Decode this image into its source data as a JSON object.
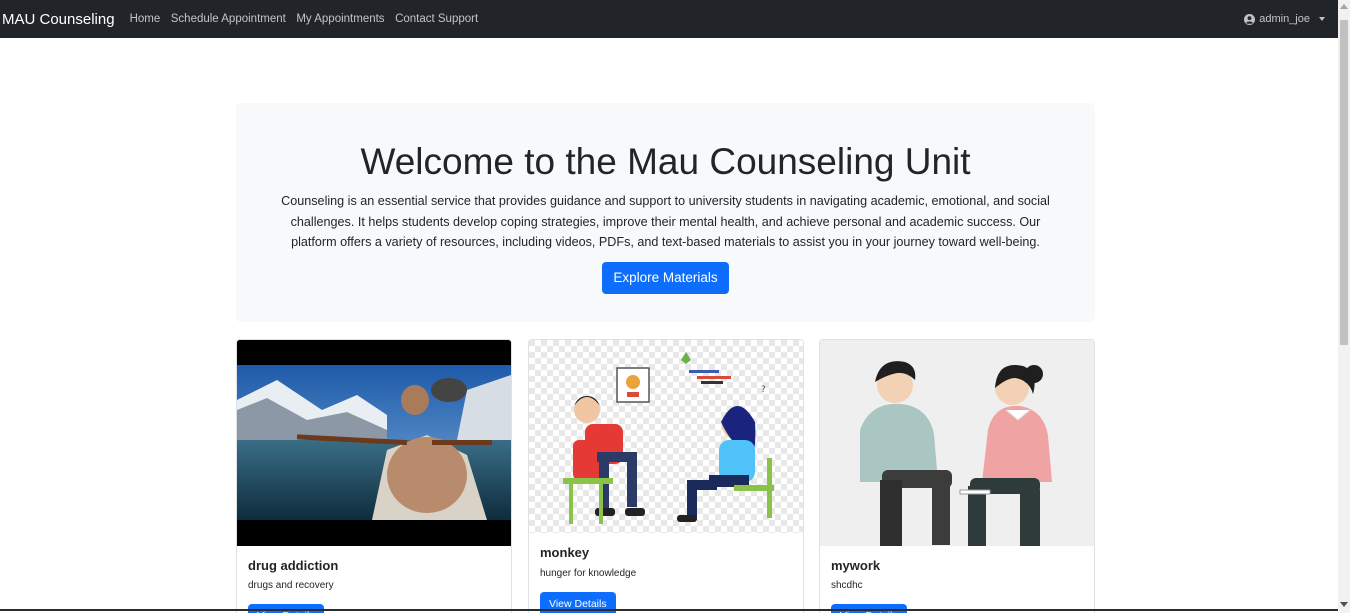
{
  "navbar": {
    "brand": "MAU Counseling",
    "links": [
      "Home",
      "Schedule Appointment",
      "My Appointments",
      "Contact Support"
    ],
    "user": "admin_joe"
  },
  "hero": {
    "title": "Welcome to the Mau Counseling Unit",
    "text": "Counseling is an essential service that provides guidance and support to university students in navigating academic, emotional, and social challenges. It helps students develop coping strategies, improve their mental health, and achieve personal and academic success. Our platform offers a variety of resources, including videos, PDFs, and text-based materials to assist you in your journey toward well-being.",
    "button": "Explore Materials"
  },
  "cards": [
    {
      "title": "drug addiction",
      "text": "drugs and recovery",
      "button": "View Details",
      "image": "video-thumbnail-boat-lake"
    },
    {
      "title": "monkey",
      "text": "hunger for knowledge",
      "button": "View Details",
      "image": "counseling-illustration"
    },
    {
      "title": "mywork",
      "text": "shcdhc",
      "button": "View Details",
      "image": "two-people-talking-illustration"
    }
  ],
  "colors": {
    "navbar": "#212529",
    "primary": "#0d6efd",
    "hero_bg": "#f8f9fa"
  }
}
